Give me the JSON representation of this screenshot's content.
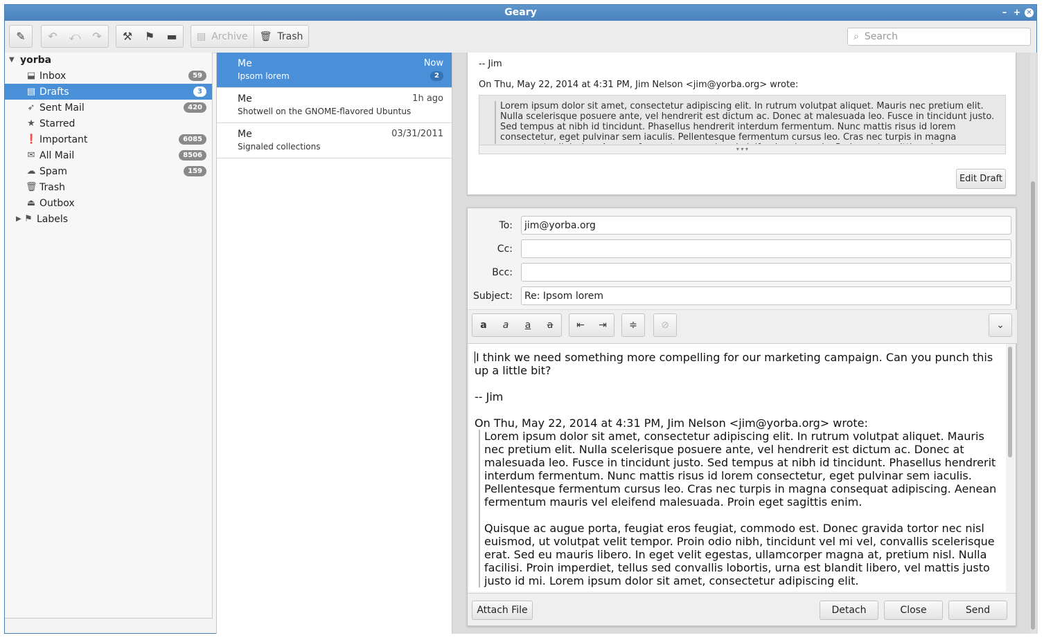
{
  "window": {
    "title": "Geary"
  },
  "toolbar": {
    "archive_label": "Archive",
    "trash_label": "Trash",
    "search_placeholder": "Search"
  },
  "sidebar": {
    "account": "yorba",
    "folders": [
      {
        "label": "Inbox",
        "count": "59",
        "icon": "inbox-icon"
      },
      {
        "label": "Drafts",
        "count": "3",
        "icon": "drafts-icon"
      },
      {
        "label": "Sent Mail",
        "count": "420",
        "icon": "sent-icon"
      },
      {
        "label": "Starred",
        "count": "",
        "icon": "star-icon"
      },
      {
        "label": "Important",
        "count": "6085",
        "icon": "important-icon"
      },
      {
        "label": "All Mail",
        "count": "8506",
        "icon": "all-mail-icon"
      },
      {
        "label": "Spam",
        "count": "159",
        "icon": "spam-icon"
      },
      {
        "label": "Trash",
        "count": "",
        "icon": "trash-icon"
      },
      {
        "label": "Outbox",
        "count": "",
        "icon": "outbox-icon"
      },
      {
        "label": "Labels",
        "count": "",
        "icon": "labels-icon"
      }
    ]
  },
  "messages": [
    {
      "from": "Me",
      "date": "Now",
      "subject": "Ipsom lorem",
      "count": "2"
    },
    {
      "from": "Me",
      "date": "1h ago",
      "subject": "Shotwell on the GNOME-flavored Ubuntus",
      "count": ""
    },
    {
      "from": "Me",
      "date": "03/31/2011",
      "subject": "Signaled collections",
      "count": ""
    }
  ],
  "draft_preview": {
    "signature": "-- Jim",
    "attribution": "On Thu, May 22, 2014 at 4:31 PM, Jim Nelson <jim@yorba.org> wrote:",
    "quote": "Lorem ipsum dolor sit amet, consectetur adipiscing elit. In rutrum volutpat aliquet. Mauris nec pretium elit. Nulla scelerisque posuere ante, vel hendrerit est dictum ac. Donec at malesuada leo. Fusce in tincidunt justo. Sed tempus at nibh id tincidunt. Phasellus hendrerit interdum fermentum. Nunc mattis risus id lorem consectetur, eget pulvinar sem iaculis. Pellentesque fermentum cursus leo. Cras nec turpis in magna consequat adipiscing. Aenean fermentum mauris vel eleifend malesuada. Proin eget sagittis enim.",
    "expand_glyph": "▾ ▾ ▾",
    "edit_draft_label": "Edit Draft"
  },
  "composer": {
    "to_label": "To:",
    "to_value": "jim@yorba.org",
    "cc_label": "Cc:",
    "cc_value": "",
    "bcc_label": "Bcc:",
    "bcc_value": "",
    "subject_label": "Subject:",
    "subject_value": "Re: Ipsom lorem",
    "body_line1": "I think we need something more compelling for our marketing campaign.  Can you punch this up a little bit?",
    "body_sig": "-- Jim",
    "body_attribution": "On Thu, May 22, 2014 at 4:31 PM, Jim Nelson <jim@yorba.org> wrote:",
    "body_quote_1": " Lorem ipsum dolor sit amet, consectetur adipiscing elit. In rutrum volutpat aliquet. Mauris nec pretium elit. Nulla scelerisque posuere ante, vel hendrerit est dictum ac. Donec at malesuada leo. Fusce in tincidunt justo. Sed tempus at nibh id tincidunt. Phasellus hendrerit interdum fermentum. Nunc mattis risus id lorem consectetur, eget pulvinar sem iaculis. Pellentesque fermentum cursus leo. Cras nec turpis in magna consequat adipiscing. Aenean fermentum mauris vel eleifend malesuada. Proin eget sagittis enim.",
    "body_quote_2": "Quisque ac augue porta, feugiat eros feugiat, commodo est. Donec gravida tortor nec nisl euismod, ut volutpat velit tempor. Proin odio nibh, tincidunt vel mi vel, convallis scelerisque erat. Sed eu mauris libero. In eget velit egestas, ullamcorper magna at, pretium nisl. Nulla facilisi. Proin imperdiet, tellus sed convallis lobortis, urna est blandit libero, vel mattis justo justo id mi. Lorem ipsum dolor sit amet, consectetur adipiscing elit.",
    "attach_label": "Attach File",
    "detach_label": "Detach",
    "close_label": "Close",
    "send_label": "Send"
  }
}
